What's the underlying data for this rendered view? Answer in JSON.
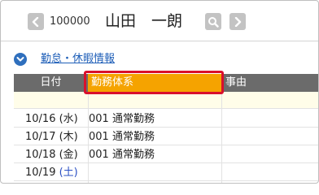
{
  "header": {
    "employee_code": "100000",
    "employee_name": "山田　一朗"
  },
  "section": {
    "title": "勤怠・休暇情報"
  },
  "table": {
    "columns": [
      "日付",
      "勤務体系",
      "事由"
    ],
    "rows": [
      {
        "date": "10/16",
        "dow": "(水)",
        "pattern": "001 通常勤務",
        "weekend": false
      },
      {
        "date": "10/17",
        "dow": "(木)",
        "pattern": "001 通常勤務",
        "weekend": false
      },
      {
        "date": "10/18",
        "dow": "(金)",
        "pattern": "001 通常勤務",
        "weekend": false
      },
      {
        "date": "10/19",
        "dow": "(土)",
        "pattern": "",
        "weekend": true
      }
    ]
  },
  "colors": {
    "header_bg": "#6b6b6b",
    "highlight_column_bg": "#f5a300",
    "highlight_border": "#d9102c",
    "link": "#1f5fb8",
    "saturday": "#2b50c4"
  },
  "icons": {
    "prev": "chevron-left-icon",
    "search": "search-icon",
    "next": "chevron-right-icon",
    "section_toggle": "chevron-down-circle-icon"
  }
}
